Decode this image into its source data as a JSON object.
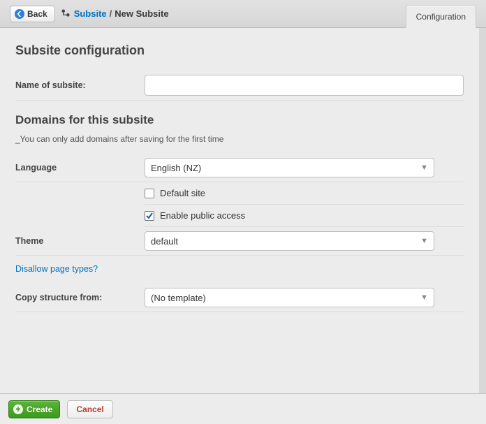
{
  "toolbar": {
    "back_label": "Back"
  },
  "breadcrumbs": {
    "root": "Subsite",
    "sep": "/",
    "current": "New Subsite"
  },
  "tabs": {
    "configuration": "Configuration"
  },
  "form": {
    "heading": "Subsite configuration",
    "name_label": "Name of subsite:",
    "name_value": "",
    "domains_heading": "Domains for this subsite",
    "domains_help": "_You can only add domains after saving for the first time",
    "language_label": "Language",
    "language_value": "English (NZ)",
    "default_site_label": "Default site",
    "default_site_checked": false,
    "public_access_label": "Enable public access",
    "public_access_checked": true,
    "theme_label": "Theme",
    "theme_value": "default",
    "disallow_link": "Disallow page types?",
    "copy_label": "Copy structure from:",
    "copy_value": "(No template)"
  },
  "actions": {
    "create": "Create",
    "cancel": "Cancel"
  }
}
